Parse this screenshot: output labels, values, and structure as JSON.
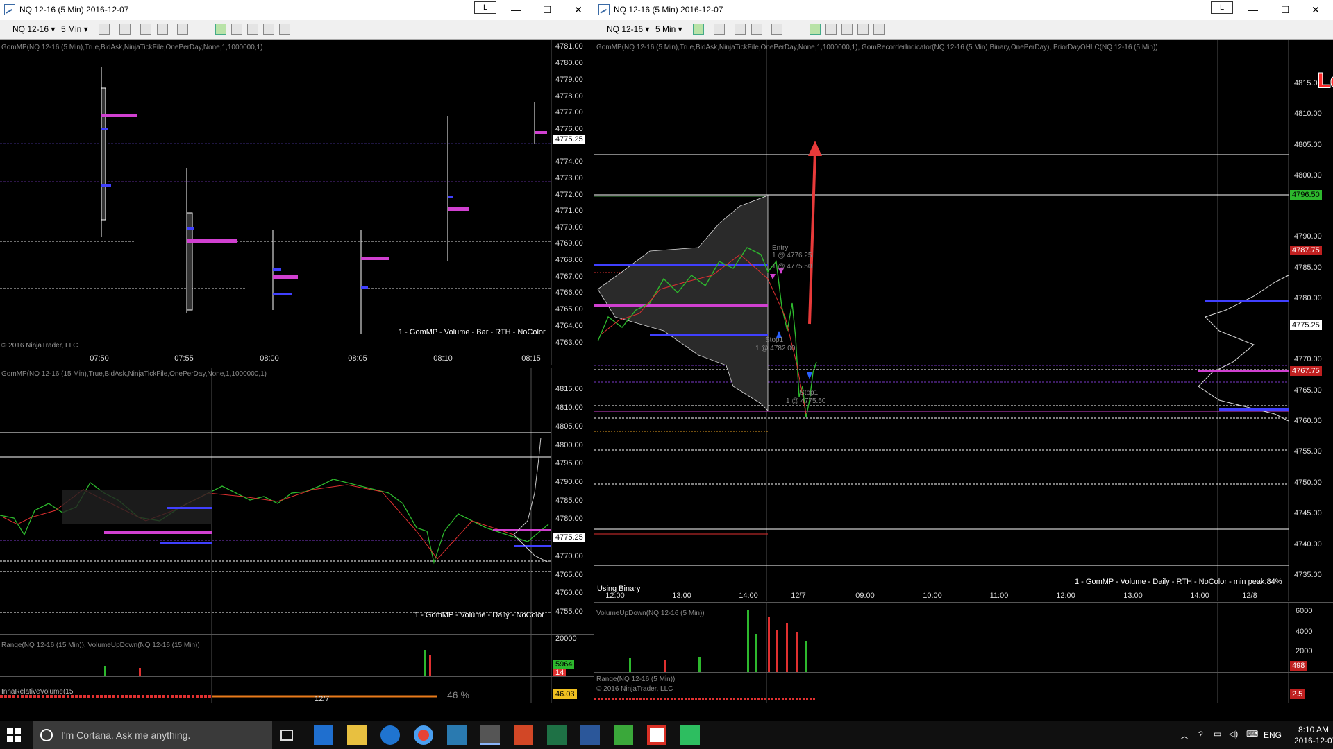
{
  "left_window": {
    "title": "NQ 12-16 (5 Min)  2016-12-07",
    "lock_label": "L",
    "toolbar": {
      "instrument": "NQ 12-16",
      "interval": "5 Min"
    },
    "top_panel": {
      "indicator_caption": "GomMP(NQ 12-16 (5 Min),True,BidAsk,NinjaTickFile,OnePerDay,None,1,1000000,1)",
      "footer_caption": "1 - GomMP  - Volume - Bar - RTH - NoColor",
      "copyright": "© 2016 NinjaTrader, LLC",
      "price_axis": [
        "4781.00",
        "4780.00",
        "4779.00",
        "4778.00",
        "4777.00",
        "4776.00",
        "4774.00",
        "4773.00",
        "4772.00",
        "4771.00",
        "4770.00",
        "4769.00",
        "4768.00",
        "4767.00",
        "4766.00",
        "4765.00",
        "4764.00",
        "4763.00"
      ],
      "last_price": "4775.25",
      "time_axis": [
        "07:50",
        "07:55",
        "08:00",
        "08:05",
        "08:10",
        "08:15"
      ]
    },
    "mid_panel": {
      "indicator_caption": "GomMP(NQ 12-16 (15 Min),True,BidAsk,NinjaTickFile,OnePerDay,None,1,1000000,1)",
      "footer_caption": "1 - GomMP  - Volume - Daily - NoColor",
      "price_axis": [
        "4815.00",
        "4810.00",
        "4805.00",
        "4800.00",
        "4795.00",
        "4790.00",
        "4785.00",
        "4780.00",
        "4770.00",
        "4765.00",
        "4760.00",
        "4755.00"
      ],
      "last_price": "4775.25"
    },
    "range_panel": {
      "caption": "Range(NQ 12-16 (15 Min)), VolumeUpDown(NQ 12-16 (15 Min))",
      "axis_top": "20000",
      "value_green": "5964",
      "value_red": "14"
    },
    "bottom_panel": {
      "caption": "InnaRelativeVolume(15",
      "percent": "46 %",
      "value_tag": "46.03",
      "date_label": "12/7"
    }
  },
  "right_window": {
    "title": "NQ 12-16 (5 Min)  2016-12-07",
    "lock_label": "L",
    "toolbar": {
      "instrument": "NQ 12-16",
      "interval": "5 Min"
    },
    "main_panel": {
      "indicator_caption": "GomMP(NQ 12-16 (5 Min),True,BidAsk,NinjaTickFile,OnePerDay,None,1,1000000,1), GomRecorderIndicator(NQ 12-16 (5 Min),Binary,OnePerDay), PriorDayOHLC(NQ 12-16 (5 Min))",
      "annotation": "Lowered stop filled",
      "using_label": "Using Binary",
      "footer_caption": "1 - GomMP  - Volume - Daily - RTH - NoColor - min peak:84%",
      "price_axis": [
        "4815.00",
        "4810.00",
        "4805.00",
        "4800.00",
        "4790.00",
        "4785.00",
        "4780.00",
        "4770.00",
        "4765.00",
        "4760.00",
        "4755.00",
        "4750.00",
        "4745.00",
        "4740.00",
        "4735.00"
      ],
      "tag_high": "4796.50",
      "tag_red1": "4787.75",
      "tag_last": "4775.25",
      "tag_red2": "4767.75",
      "order_labels": {
        "entry": "Entry",
        "entry_price": "1 @ 4776.25",
        "target": "1 @ 4775.50",
        "stop_upper": "Stop1",
        "stop_upper_price": "1 @ 4782.00",
        "stop_lower": "Stop1",
        "stop_lower_price": "1 @ 4775.50"
      }
    },
    "volume_panel": {
      "caption": "VolumeUpDown(NQ 12-16 (5 Min))",
      "axis": [
        "6000",
        "4000",
        "2000"
      ],
      "value_tag": "498"
    },
    "range_panel": {
      "caption": "Range(NQ 12-16 (5 Min))",
      "copyright": "© 2016 NinjaTrader, LLC",
      "value_tag": "2.5"
    },
    "time_axis": [
      "12:00",
      "13:00",
      "14:00",
      "12/7",
      "09:00",
      "10:00",
      "11:00",
      "12:00",
      "13:00",
      "14:00",
      "12/8"
    ]
  },
  "taskbar": {
    "search_placeholder": "I'm Cortana. Ask me anything.",
    "language": "ENG",
    "time": "8:10 AM",
    "date": "2016-12-07",
    "icons": [
      "task-view-icon",
      "outlook-icon",
      "file-explorer-icon",
      "edge-icon",
      "chrome-icon",
      "tws-icon",
      "ninjatrader-icon",
      "powerpoint-icon",
      "excel-icon",
      "word-icon",
      "camtasia-icon",
      "gmail-icon",
      "evernote-icon"
    ]
  }
}
